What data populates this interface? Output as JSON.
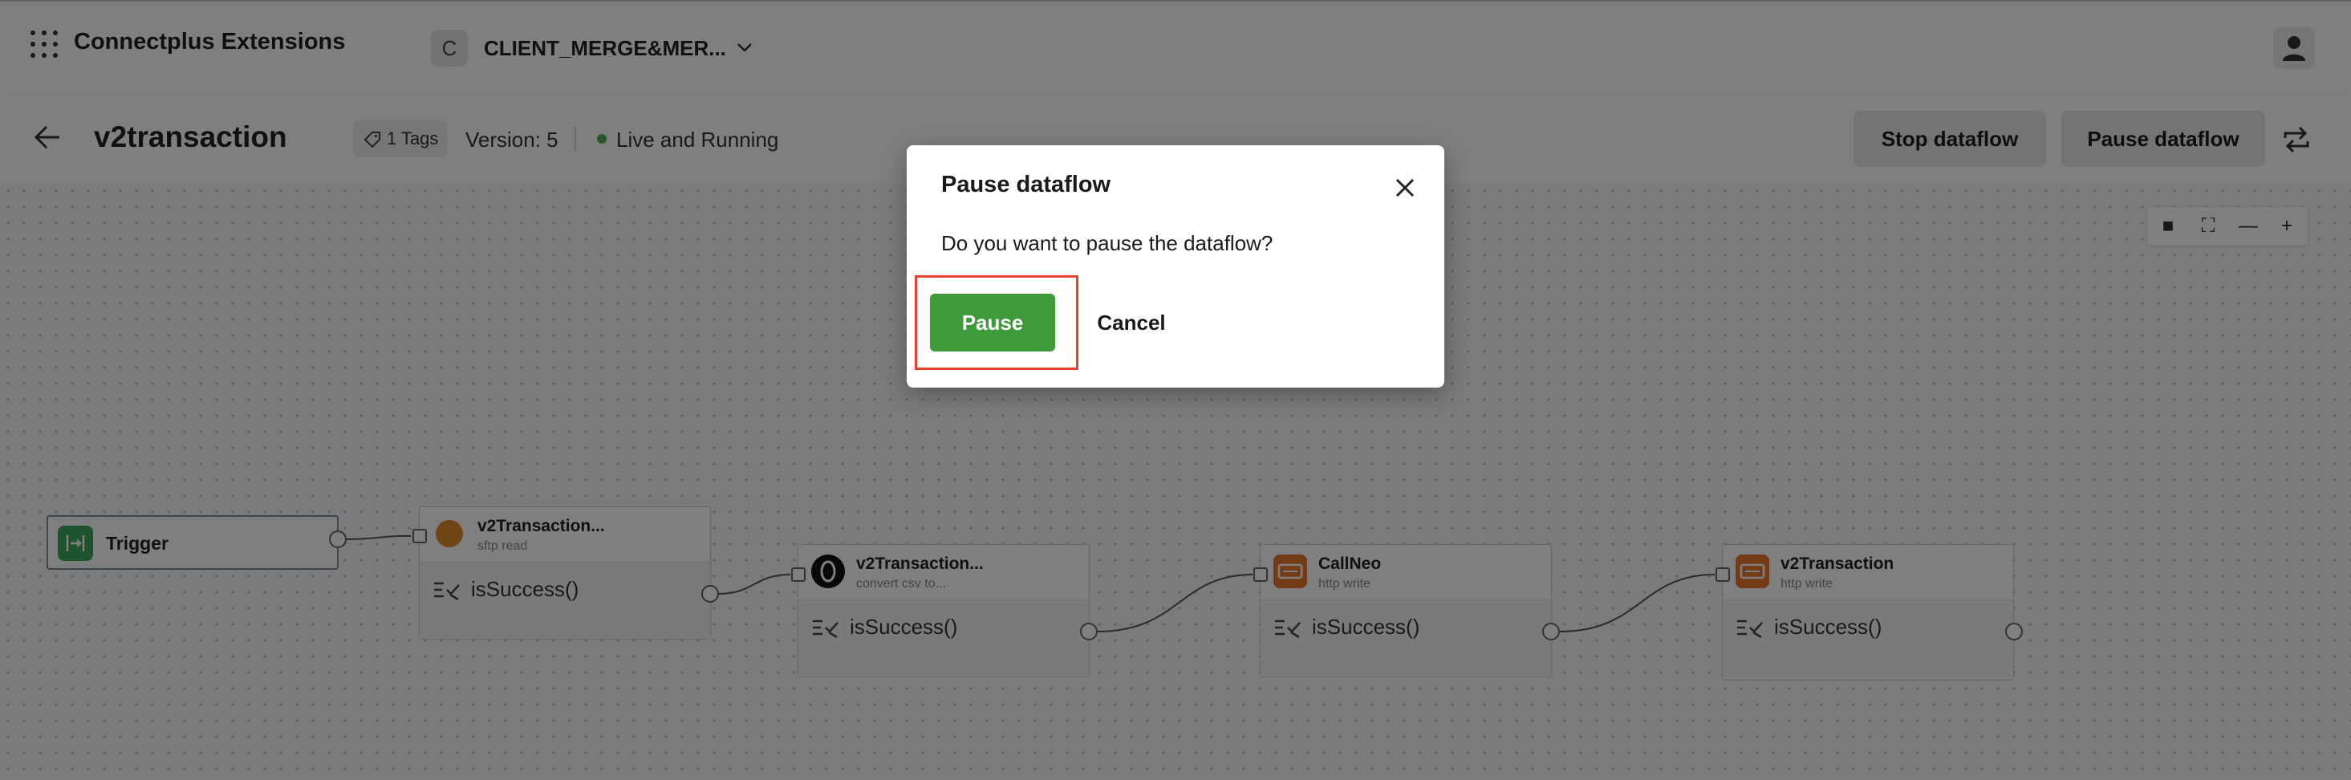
{
  "app": {
    "title": "Connectplus Extensions"
  },
  "workspace": {
    "avatar_letter": "C",
    "name": "CLIENT_MERGE&MER..."
  },
  "dataflow": {
    "name": "v2transaction",
    "tags_label": "1 Tags",
    "version_label": "Version: 5",
    "status": "Live and Running",
    "status_color": "#4caf50",
    "stop_label": "Stop dataflow",
    "pause_label": "Pause dataflow"
  },
  "nodes": {
    "trigger": {
      "title": "Trigger"
    },
    "n1": {
      "title": "v2Transaction...",
      "subtitle": "sftp read",
      "condition": "isSuccess()"
    },
    "n2": {
      "title": "v2Transaction...",
      "subtitle": "convert csv to...",
      "condition": "isSuccess()"
    },
    "n3": {
      "title": "CallNeo",
      "subtitle": "http write",
      "condition": "isSuccess()"
    },
    "n4": {
      "title": "v2Transaction",
      "subtitle": "http write",
      "condition": "isSuccess()"
    }
  },
  "modal": {
    "title": "Pause dataflow",
    "message": "Do you want to pause the dataflow?",
    "confirm_label": "Pause",
    "cancel_label": "Cancel"
  },
  "colors": {
    "accent_green": "#3f9a3a",
    "highlight_red": "#e5432d",
    "http_orange": "#e8772e",
    "sftp_orange": "#e08a2c"
  }
}
